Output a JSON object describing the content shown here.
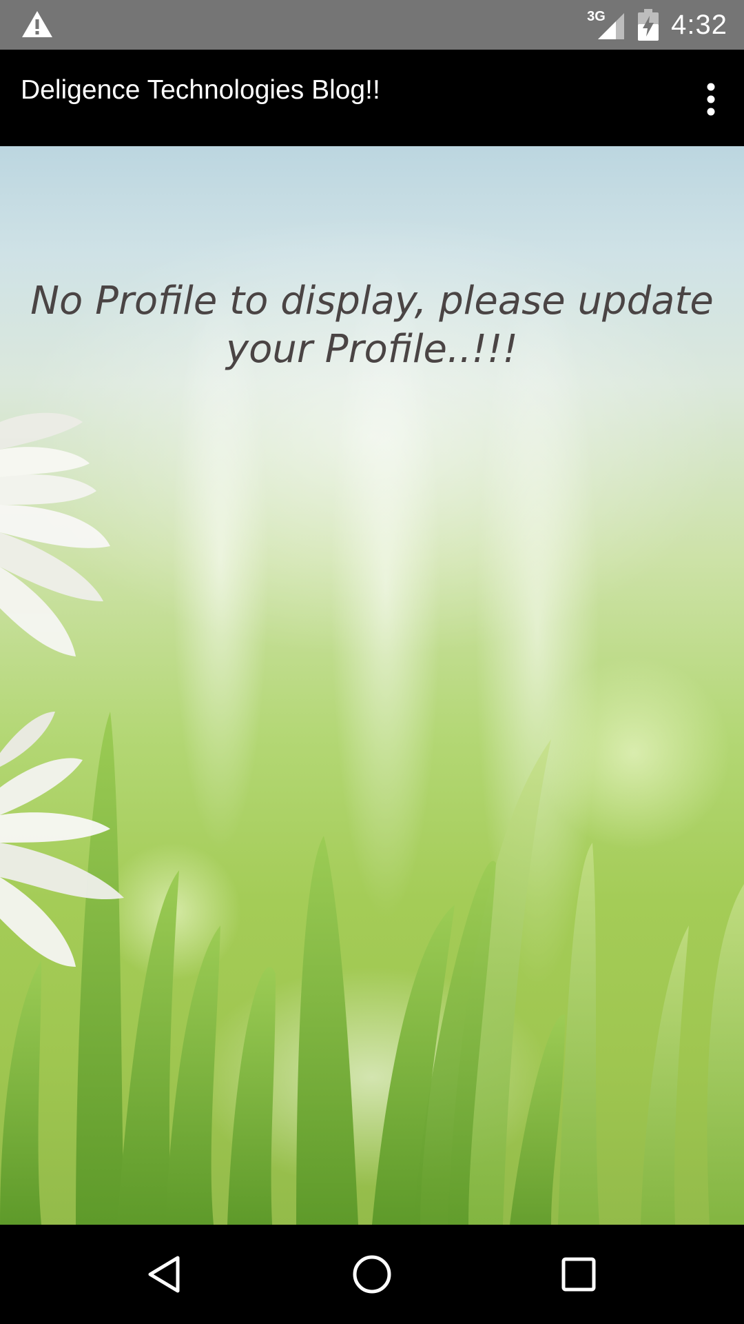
{
  "status_bar": {
    "network_type": "3G",
    "time": "4:32",
    "icons": [
      "warning-icon",
      "signal-icon",
      "battery-charging-icon"
    ]
  },
  "app_bar": {
    "title": "Deligence Technologies Blog!!",
    "menu_icon": "overflow-menu-icon"
  },
  "main": {
    "message": "No Profile to display, please update your Profile..!!!"
  },
  "nav_bar": {
    "icons": [
      "back-icon",
      "home-icon",
      "recents-icon"
    ]
  },
  "colors": {
    "status_bar": "#757575",
    "app_bar": "#000000",
    "message_text": "#4a4444",
    "nav_bar": "#000000"
  }
}
